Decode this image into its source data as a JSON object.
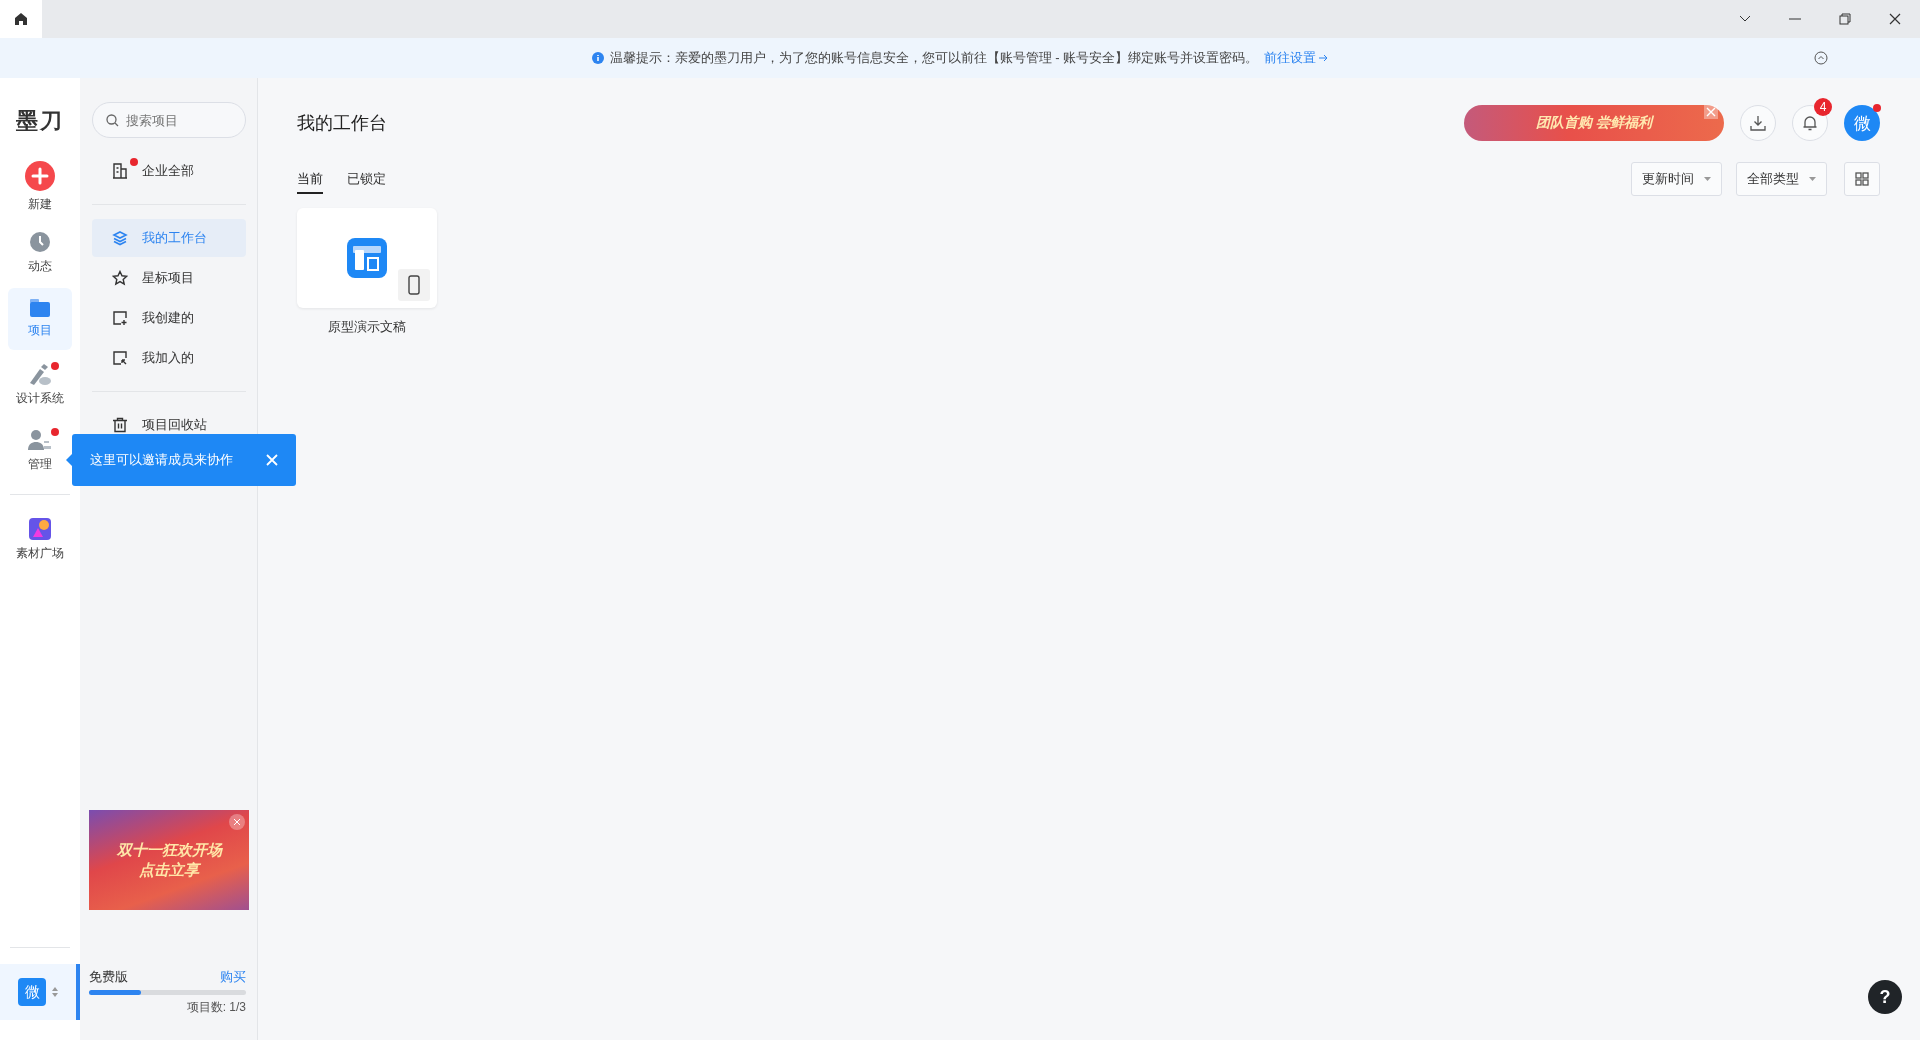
{
  "notice": {
    "text": "温馨提示：亲爱的墨刀用户，为了您的账号信息安全，您可以前往【账号管理 - 账号安全】绑定账号并设置密码。",
    "link": "前往设置"
  },
  "rail": {
    "logo": "墨刀",
    "groups": [
      [
        {
          "label": "新建",
          "selected": false,
          "dot": false
        },
        {
          "label": "动态",
          "selected": false,
          "dot": false
        },
        {
          "label": "项目",
          "selected": true,
          "dot": false
        },
        {
          "label": "设计系统",
          "selected": false,
          "dot": true
        },
        {
          "label": "管理",
          "selected": false,
          "dot": true
        }
      ],
      [
        {
          "label": "素材广场",
          "selected": false,
          "dot": false
        }
      ]
    ],
    "team": {
      "avatar": "微",
      "selected": true
    }
  },
  "sidebar": {
    "search": {
      "placeholder": "搜索项目"
    },
    "groups": [
      [
        {
          "label": "企业全部",
          "selected": false,
          "dot": true
        }
      ],
      [
        {
          "label": "我的工作台",
          "selected": true,
          "dot": false
        },
        {
          "label": "星标项目",
          "selected": false,
          "dot": false
        },
        {
          "label": "我创建的",
          "selected": false,
          "dot": false
        },
        {
          "label": "我加入的",
          "selected": false,
          "dot": false
        }
      ],
      [
        {
          "label": "项目回收站",
          "selected": false,
          "dot": false
        }
      ]
    ],
    "promo": {
      "title": "双十一狂欢开场",
      "subtitle": "点击立享"
    },
    "plan": {
      "name": "免费版",
      "buy": "购买",
      "level": 0.33,
      "count": "项目数: 1/3"
    }
  },
  "tooltip": {
    "text": "这里可以邀请成员来协作"
  },
  "main": {
    "title": "我的工作台",
    "banner": "团队首购 尝鲜福利",
    "notification_badge": "4",
    "avatar": {
      "text": "微",
      "dot": true
    },
    "tabs": [
      {
        "label": "当前",
        "selected": true
      },
      {
        "label": "已锁定",
        "selected": false
      }
    ],
    "sort": [
      "更新时间",
      "全部类型"
    ],
    "projects": [
      {
        "name": "原型演示文稿"
      }
    ],
    "help": "?"
  }
}
